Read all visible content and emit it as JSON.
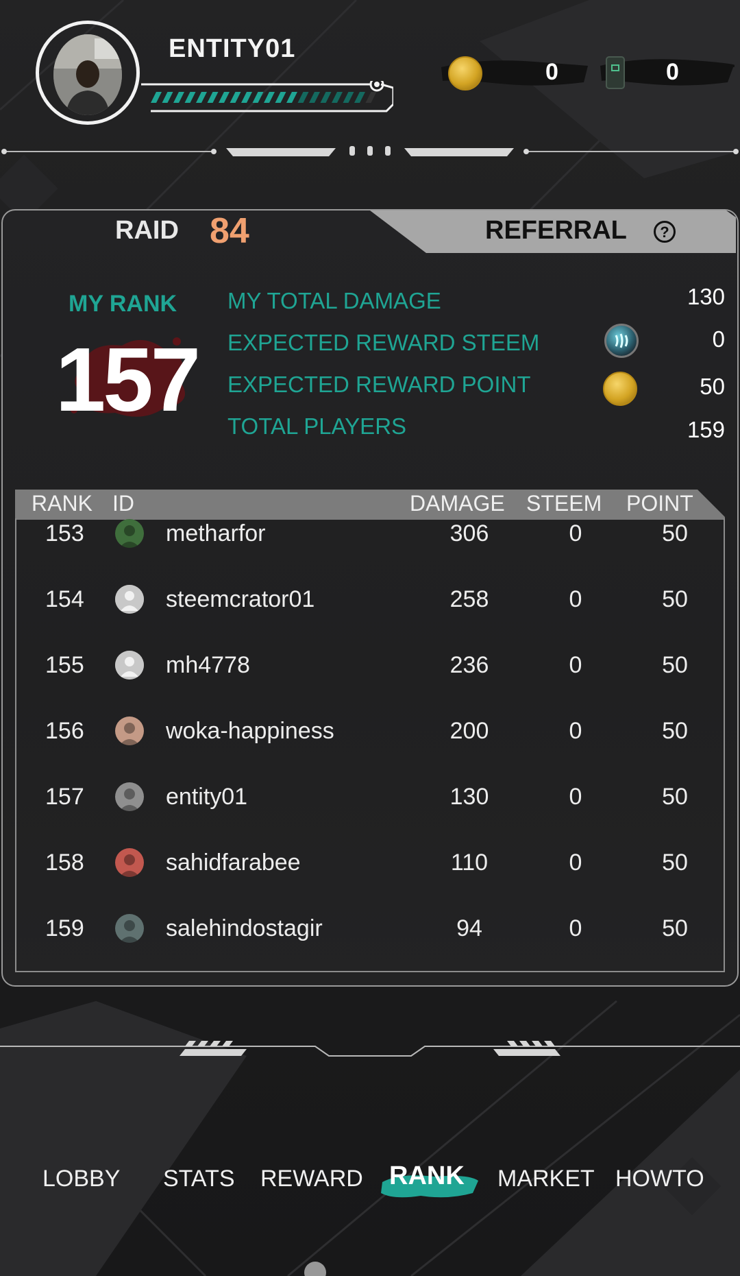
{
  "header": {
    "username": "ENTITY01",
    "xp_fraction": 0.93,
    "resources": [
      {
        "icon": "gold-coin-icon",
        "value": "0"
      },
      {
        "icon": "green-card-icon",
        "value": "0"
      }
    ]
  },
  "tabs": {
    "raid_label": "RAID",
    "raid_value": "84",
    "referral_label": "REFERRAL",
    "help_symbol": "?"
  },
  "my_rank": {
    "label": "MY RANK",
    "value": "157"
  },
  "stats": {
    "total_damage": {
      "label": "MY TOTAL DAMAGE",
      "value": "130"
    },
    "reward_steem": {
      "label": "EXPECTED REWARD STEEM",
      "value": "0",
      "icon": "steem-icon"
    },
    "reward_point": {
      "label": "EXPECTED REWARD POINT",
      "value": "50",
      "icon": "gold-coin-icon"
    },
    "total_players": {
      "label": "TOTAL PLAYERS",
      "value": "159"
    }
  },
  "table": {
    "columns": [
      "RANK",
      "ID",
      "DAMAGE",
      "STEEM",
      "POINT"
    ],
    "rows": [
      {
        "rank": "153",
        "id": "metharfor",
        "damage": "306",
        "steem": "0",
        "point": "50",
        "avatar": "photo"
      },
      {
        "rank": "154",
        "id": "steemcrator01",
        "damage": "258",
        "steem": "0",
        "point": "50",
        "avatar": "default"
      },
      {
        "rank": "155",
        "id": "mh4778",
        "damage": "236",
        "steem": "0",
        "point": "50",
        "avatar": "default"
      },
      {
        "rank": "156",
        "id": "woka-happiness",
        "damage": "200",
        "steem": "0",
        "point": "50",
        "avatar": "photo"
      },
      {
        "rank": "157",
        "id": "entity01",
        "damage": "130",
        "steem": "0",
        "point": "50",
        "avatar": "photo"
      },
      {
        "rank": "158",
        "id": "sahidfarabee",
        "damage": "110",
        "steem": "0",
        "point": "50",
        "avatar": "photo"
      },
      {
        "rank": "159",
        "id": "salehindostagir",
        "damage": "94",
        "steem": "0",
        "point": "50",
        "avatar": "photo"
      }
    ]
  },
  "nav": {
    "items": [
      "LOBBY",
      "STATS",
      "REWARD",
      "RANK",
      "MARKET",
      "HOWTO"
    ],
    "active": "RANK"
  },
  "colors": {
    "accent_teal": "#1fa594",
    "raid_orange": "#f0a070",
    "background": "#1b1b1c"
  }
}
